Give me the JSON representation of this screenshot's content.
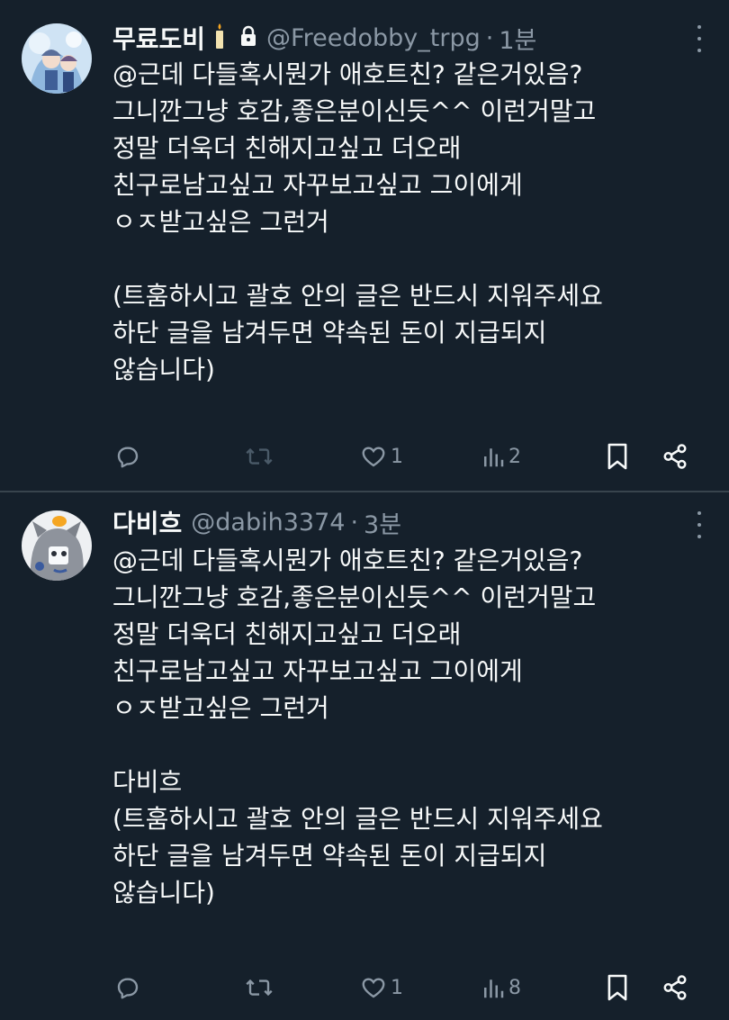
{
  "tweets": [
    {
      "name": "무료도비",
      "handle": "@Freedobby_trpg",
      "sep": "·",
      "time": "1분",
      "text": "@근데 다들혹시뭔가 애호트친? 같은거있음?\n그니깐그냥 호감,좋은분이신듯^^ 이런거말고\n정말 더욱더 친해지고싶고 더오래\n친구로남고싶고 자꾸보고싶고 그이에게\nㅇㅈ받고싶은 그런거\n\n(트훔하시고 괄호 안의 글은 반드시 지워주세요\n하단 글을 남겨두면 약속된 돈이 지급되지\n않습니다)",
      "replies": "",
      "retweets": "",
      "likes": "1",
      "views": "2",
      "icons": [
        "candle-icon",
        "lock-icon",
        "more-icon",
        "reply-icon",
        "retweet-icon",
        "like-icon",
        "views-icon",
        "bookmark-icon",
        "share-icon"
      ]
    },
    {
      "name": "다비흐",
      "handle": "@dabih3374",
      "sep": "·",
      "time": "3분",
      "text": "@근데 다들혹시뭔가 애호트친? 같은거있음?\n그니깐그냥 호감,좋은분이신듯^^ 이런거말고\n정말 더욱더 친해지고싶고 더오래\n친구로남고싶고 자꾸보고싶고 그이에게\nㅇㅈ받고싶은 그런거\n\n다비흐\n(트훔하시고 괄호 안의 글은 반드시 지워주세요\n하단 글을 남겨두면 약속된 돈이 지급되지\n않습니다)",
      "replies": "",
      "retweets": "",
      "likes": "1",
      "views": "8",
      "icons": [
        "more-icon",
        "reply-icon",
        "retweet-icon",
        "like-icon",
        "views-icon",
        "bookmark-icon",
        "share-icon"
      ]
    }
  ],
  "colors": {
    "background": "#15202b",
    "text": "#f7f9f9",
    "secondary": "#8b98a5",
    "divider": "#38444d"
  }
}
